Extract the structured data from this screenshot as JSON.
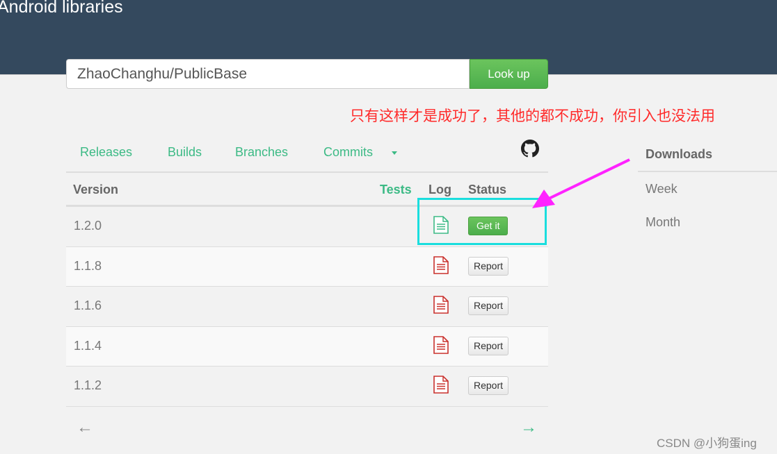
{
  "header": {
    "brand": "Android libraries"
  },
  "search": {
    "value": "ZhaoChanghu/PublicBase",
    "button": "Look up"
  },
  "annotation": {
    "text": "只有这样才是成功了，其他的都不成功，你引入也没法用",
    "arrow_color": "#ff22ff",
    "highlight_color": "#1adede"
  },
  "tabs": [
    {
      "label": "Releases"
    },
    {
      "label": "Builds"
    },
    {
      "label": "Branches"
    },
    {
      "label": "Commits"
    }
  ],
  "table": {
    "headers": {
      "version": "Version",
      "tests": "Tests",
      "log": "Log",
      "status": "Status"
    },
    "rows": [
      {
        "version": "1.2.0",
        "status": "Get it",
        "ok": true
      },
      {
        "version": "1.1.8",
        "status": "Report",
        "ok": false
      },
      {
        "version": "1.1.6",
        "status": "Report",
        "ok": false
      },
      {
        "version": "1.1.4",
        "status": "Report",
        "ok": false
      },
      {
        "version": "1.1.2",
        "status": "Report",
        "ok": false
      }
    ]
  },
  "pagination": {
    "prev": "←",
    "next": "→"
  },
  "downloads": {
    "title": "Downloads",
    "items": [
      "Week",
      "Month"
    ]
  },
  "watermark": "CSDN @小狗蛋ing"
}
